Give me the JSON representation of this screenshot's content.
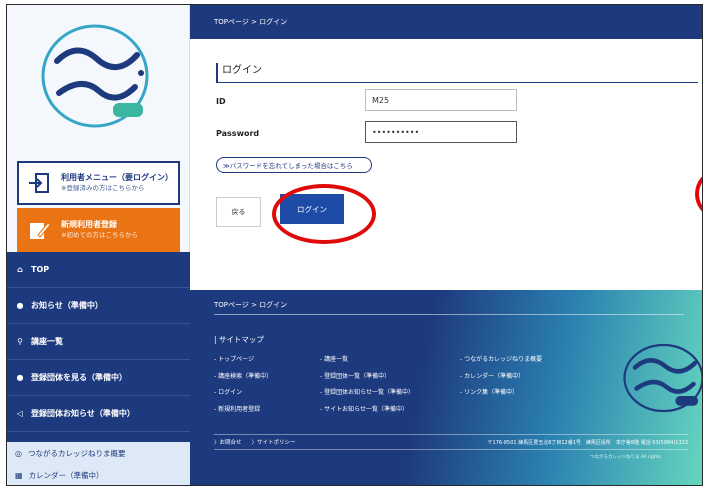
{
  "sidebar": {
    "logo_text": "つながるカレッジねりま",
    "member_button": {
      "main": "利用者メニュー（要ログイン）",
      "sub": "※登録済みの方はこちらから"
    },
    "register_button": {
      "main": "新規利用者登録",
      "sub": "※初めての方はこちらから"
    },
    "nav": [
      {
        "icon": "house",
        "label": "TOP"
      },
      {
        "icon": "circle",
        "label": "お知らせ（準備中）"
      },
      {
        "icon": "magnifier",
        "label": "講座一覧"
      },
      {
        "icon": "circle",
        "label": "登録団体を見る（準備中）"
      },
      {
        "icon": "megaphone",
        "label": "登録団体お知らせ（準備中）"
      }
    ],
    "bottom_nav": [
      {
        "label": "つながるカレッジねりま概要"
      },
      {
        "label": "カレンダー（準備中）"
      }
    ]
  },
  "header": {
    "breadcrumb": "TOPページ > ログイン"
  },
  "login": {
    "title": "ログイン",
    "id_label": "ID",
    "id_value": "M25",
    "password_label": "Password",
    "password_value": "••••••••••",
    "forgot_link": "≫パスワードを忘れてしまった場合はこちら",
    "back_button": "戻る",
    "login_button": "ログイン"
  },
  "footer": {
    "breadcrumb": "TOPページ > ログイン",
    "sitemap_title": "| サイトマップ",
    "col1": [
      "- トップページ",
      "- 講座検索（準備中）",
      "- ログイン",
      "- 新規利用者登録"
    ],
    "col2": [
      "- 講座一覧",
      "- 登録団体一覧（準備中）",
      "- 登録団体お知らせ一覧（準備中）",
      "- サイトお知らせ一覧（準備中）"
    ],
    "col3": [
      "- つながるカレッジねりま概要",
      "- カレンダー（準備中）",
      "- リンク集（準備中）"
    ],
    "links": [
      "〉お問合せ",
      "〉サイトポリシー"
    ],
    "address": "〒176-8501 練馬区豊玉北6丁目12番1号　練馬区役所　本庁舎8階 電話 03(5984)1313",
    "copyright": "つながるカレッジねりま All rights"
  },
  "colors": {
    "navy": "#1e3a7e",
    "orange": "#ea7313",
    "annotation_red": "#e00a0a",
    "login_blue": "#1e4aa8"
  }
}
